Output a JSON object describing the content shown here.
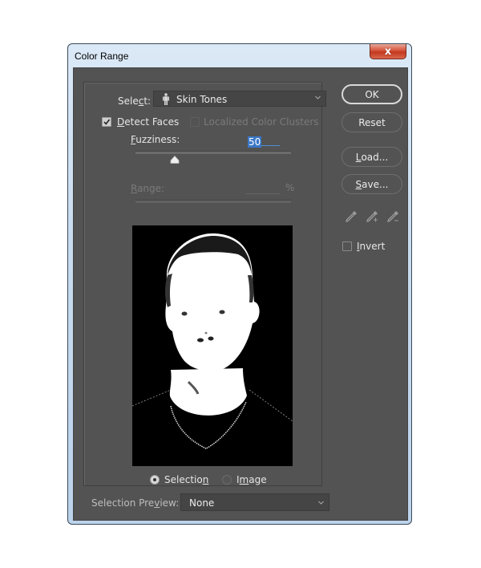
{
  "window": {
    "title": "Color Range",
    "close_label": "x"
  },
  "select": {
    "label_pre": "Sele",
    "label_u": "c",
    "label_post": "t:",
    "value": "Skin Tones",
    "icon": "person-icon"
  },
  "detect_faces": {
    "label_u": "D",
    "label_post": "etect Faces",
    "checked": true
  },
  "localized_clusters": {
    "label": "Localized Color Clusters",
    "checked": false,
    "enabled": false
  },
  "fuzziness": {
    "label_u": "F",
    "label_post": "uzziness:",
    "value": "50",
    "slider_fraction": 0.25
  },
  "range": {
    "label_u": "R",
    "label_post": "ange:",
    "value": "",
    "unit": "%",
    "enabled": false
  },
  "preview_mode": {
    "selection_pre": "Selectio",
    "selection_u": "n",
    "image_pre": "I",
    "image_u": "m",
    "image_post": "age",
    "selected": "Selection"
  },
  "buttons": {
    "ok": "OK",
    "reset": "Reset",
    "load_u": "L",
    "load_post": "oad...",
    "save_u": "S",
    "save_post": "ave..."
  },
  "eyedroppers": [
    "eyedropper-icon",
    "eyedropper-add-icon",
    "eyedropper-subtract-icon"
  ],
  "invert": {
    "label_u": "I",
    "label_post": "nvert",
    "checked": false
  },
  "selection_preview": {
    "label_pre": "Selection Pre",
    "label_u": "v",
    "label_post": "iew:",
    "value": "None"
  }
}
